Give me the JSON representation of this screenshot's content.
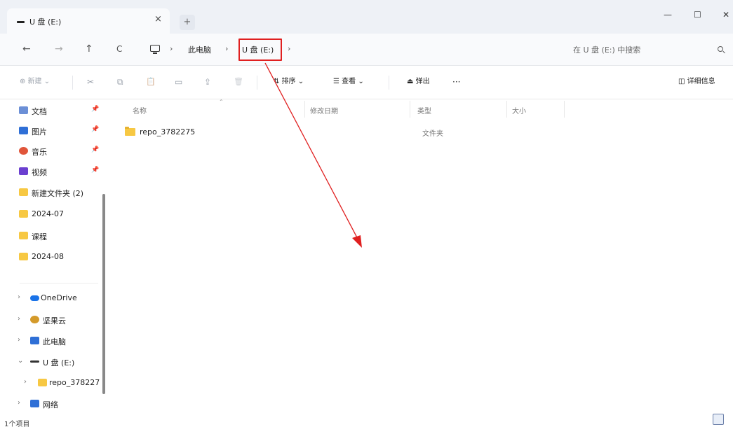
{
  "window": {
    "tab_title": "U 盘 (E:)",
    "tab_close": "×",
    "new_tab": "+",
    "minimize": "—",
    "maximize": "☐",
    "close": "✕"
  },
  "nav": {
    "back": "←",
    "forward": "→",
    "up": "↑",
    "refresh": "C",
    "breadcrumb": [
      "此电脑",
      "U 盘 (E:)"
    ],
    "separator": "›",
    "search_placeholder": "在 U 盘 (E:) 中搜索"
  },
  "toolbar": {
    "new": "⊕ 新建 ⌄",
    "cut": "✂",
    "copy": "⧉",
    "paste": "📋",
    "rename": "▭",
    "share": "⇪",
    "delete": "🗑",
    "sort": "⇅ 排序 ⌄",
    "view": "☰ 查看 ⌄",
    "eject": "⏏ 弹出",
    "more": "···",
    "details": "◫ 详细信息"
  },
  "sidebar": {
    "quick_access": [
      {
        "label": "文档",
        "icon": "document-icon",
        "color": "#6b8fd6"
      },
      {
        "label": "图片",
        "icon": "picture-icon",
        "color": "#2f6fd6"
      },
      {
        "label": "音乐",
        "icon": "music-icon",
        "color": "#e0553a"
      },
      {
        "label": "视频",
        "icon": "video-icon",
        "color": "#6b3fd0"
      },
      {
        "label": "新建文件夹 (2)",
        "icon": "folder-icon",
        "color": "#f7c843"
      },
      {
        "label": "2024-07",
        "icon": "folder-icon",
        "color": "#f7c843"
      },
      {
        "label": "课程",
        "icon": "folder-icon",
        "color": "#f7c843"
      },
      {
        "label": "2024-08",
        "icon": "folder-icon",
        "color": "#f7c843"
      }
    ],
    "pin": "📌",
    "tree": [
      {
        "label": "OneDrive",
        "icon": "onedrive-icon",
        "color": "#1a73e8",
        "chevron": "›"
      },
      {
        "label": "坚果云",
        "icon": "nutstore-icon",
        "color": "#d49a2a",
        "chevron": "›"
      },
      {
        "label": "此电脑",
        "icon": "pc-icon",
        "color": "#2f6fd6",
        "chevron": "›"
      },
      {
        "label": "U 盘 (E:)",
        "icon": "usb-drive-icon",
        "color": "#333333",
        "chevron": "⌄"
      },
      {
        "label": "repo_378227",
        "icon": "folder-icon",
        "color": "#f7c843",
        "chevron": "›"
      },
      {
        "label": "网络",
        "icon": "network-icon",
        "color": "#2f6fd6",
        "chevron": "›"
      }
    ]
  },
  "main": {
    "columns": [
      "名称",
      "修改日期",
      "类型",
      "大小"
    ],
    "sort_indicator": "⌃",
    "files": [
      {
        "name": "repo_3782275",
        "modified": "",
        "type": "文件夹",
        "size": ""
      }
    ]
  },
  "status": {
    "item_count": "1个项目"
  },
  "colors": {
    "annotation_red": "#e02020",
    "folder_yellow": "#f7c843",
    "accent_blue": "#2f6fd6"
  }
}
